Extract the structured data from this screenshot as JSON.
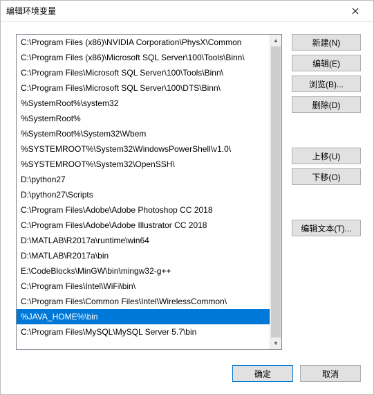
{
  "window": {
    "title": "编辑环境变量"
  },
  "list": {
    "selected_index": 16,
    "items": [
      "C:\\Program Files (x86)\\NVIDIA Corporation\\PhysX\\Common",
      "C:\\Program Files (x86)\\Microsoft SQL Server\\100\\Tools\\Binn\\",
      "C:\\Program Files\\Microsoft SQL Server\\100\\Tools\\Binn\\",
      "C:\\Program Files\\Microsoft SQL Server\\100\\DTS\\Binn\\",
      "%SystemRoot%\\system32",
      "%SystemRoot%",
      "%SystemRoot%\\System32\\Wbem",
      "%SYSTEMROOT%\\System32\\WindowsPowerShell\\v1.0\\",
      "%SYSTEMROOT%\\System32\\OpenSSH\\",
      "D:\\python27",
      "D:\\python27\\Scripts",
      "C:\\Program Files\\Adobe\\Adobe Photoshop CC 2018",
      "C:\\Program Files\\Adobe\\Adobe Illustrator CC 2018",
      "D:\\MATLAB\\R2017a\\runtime\\win64",
      "D:\\MATLAB\\R2017a\\bin",
      "E:\\CodeBlocks\\MinGW\\bin\\mingw32-g++",
      "%JAVA_HOME%\\bin",
      "C:\\Program Files\\MySQL\\MySQL Server 5.7\\bin",
      "C:\\Program Files\\Intel\\WiFi\\bin\\",
      "C:\\Program Files\\Common Files\\Intel\\WirelessCommon\\"
    ],
    "visible_order": [
      0,
      1,
      2,
      3,
      4,
      5,
      6,
      7,
      8,
      9,
      10,
      11,
      12,
      13,
      14,
      15,
      18,
      19,
      16,
      17
    ]
  },
  "buttons": {
    "new": "新建(N)",
    "edit": "编辑(E)",
    "browse": "浏览(B)...",
    "delete": "删除(D)",
    "moveup": "上移(U)",
    "movedown": "下移(O)",
    "edittext": "编辑文本(T)...",
    "ok": "确定",
    "cancel": "取消"
  },
  "scroll": {
    "up_glyph": "▲",
    "down_glyph": "▼"
  }
}
